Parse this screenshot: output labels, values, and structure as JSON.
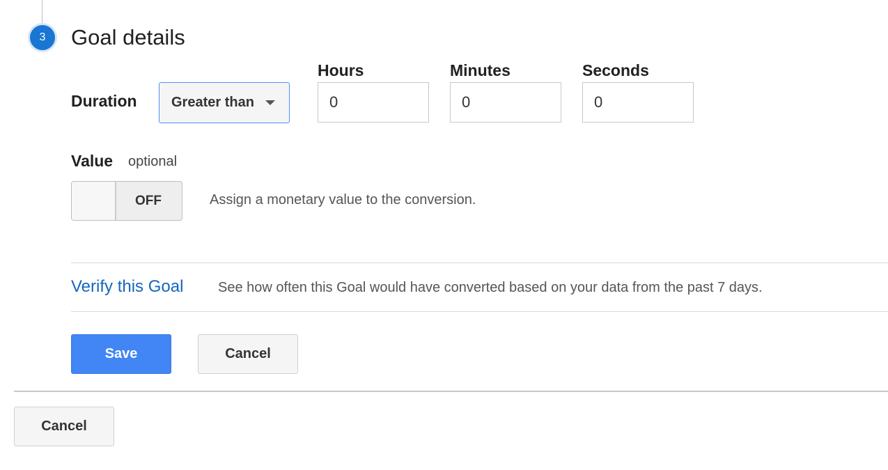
{
  "step": {
    "number": "3",
    "title": "Goal details"
  },
  "duration": {
    "label": "Duration",
    "comparison": "Greater than",
    "hours_label": "Hours",
    "hours_value": "0",
    "minutes_label": "Minutes",
    "minutes_value": "0",
    "seconds_label": "Seconds",
    "seconds_value": "0"
  },
  "value": {
    "label": "Value",
    "optional_text": "optional",
    "toggle_state": "OFF",
    "description": "Assign a monetary value to the conversion."
  },
  "verify": {
    "link_text": "Verify this Goal",
    "description": "See how often this Goal would have converted based on your data from the past 7 days."
  },
  "actions": {
    "save_label": "Save",
    "cancel_label": "Cancel"
  },
  "footer": {
    "cancel_label": "Cancel"
  },
  "colors": {
    "accent": "#1976d2",
    "link": "#1565c0",
    "primary_button": "#4285f4"
  },
  "icons": {
    "dropdown": "caret-down-icon"
  }
}
